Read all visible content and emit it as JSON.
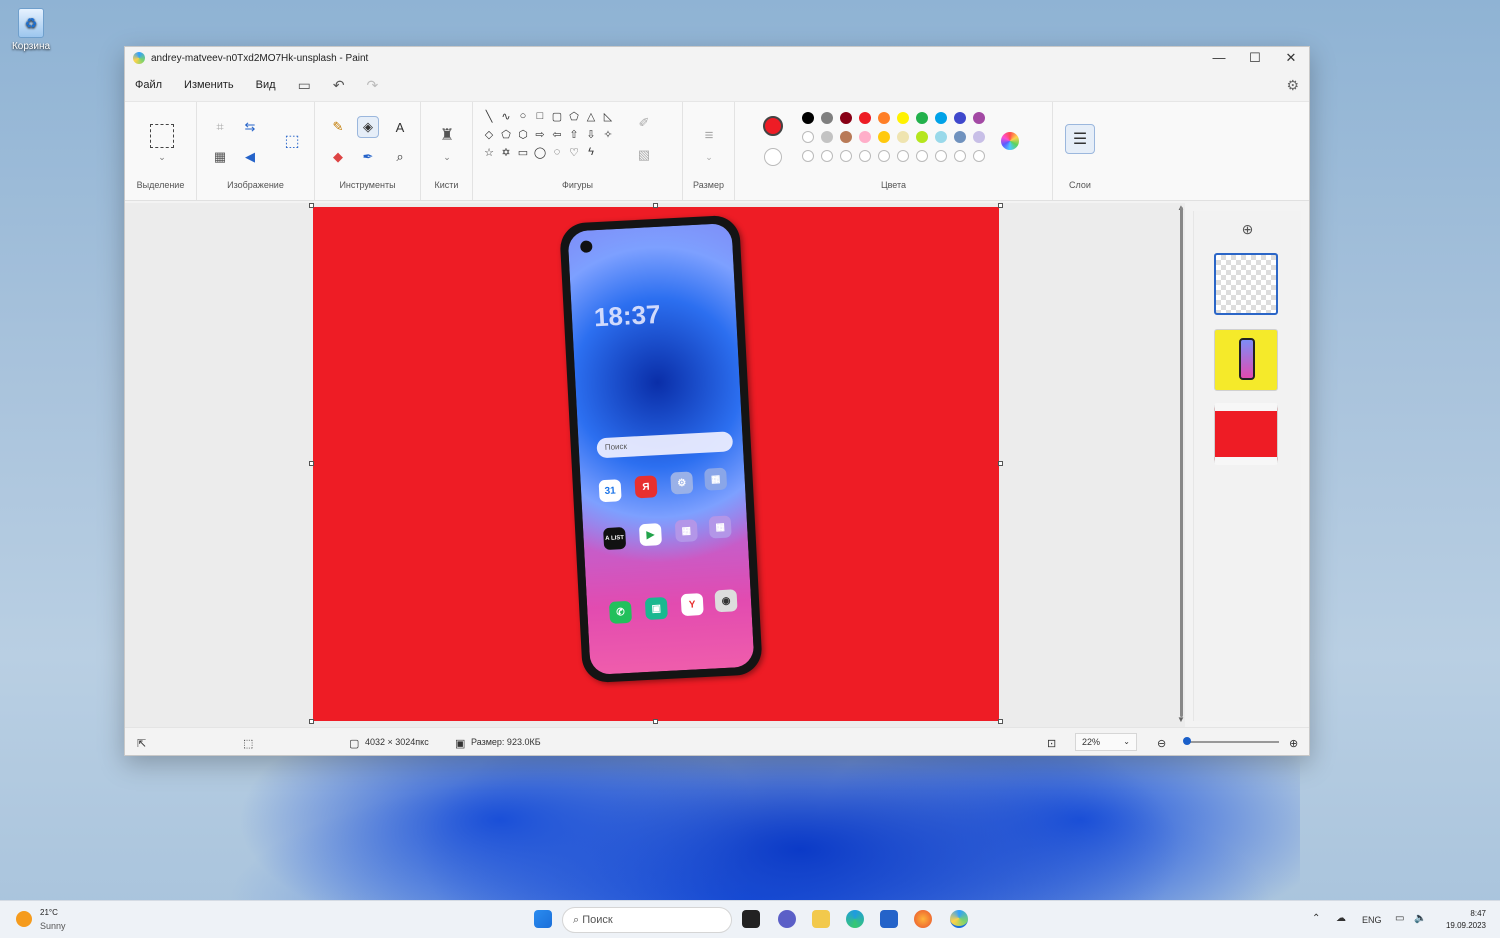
{
  "desktop": {
    "recycle_bin_label": "Корзина"
  },
  "window": {
    "title": "andrey-matveev-n0Txd2MO7Hk-unsplash - Paint",
    "controls": {
      "minimize": "—",
      "maximize": "☐",
      "close": "✕"
    }
  },
  "menu": {
    "file": "Файл",
    "edit": "Изменить",
    "view": "Вид"
  },
  "quick_access": {
    "save_icon": "💾",
    "undo_icon": "↶",
    "redo_icon": "↷",
    "settings_icon": "⚙"
  },
  "ribbon": {
    "groups": {
      "selection": "Выделение",
      "image": "Изображение",
      "tools": "Инструменты",
      "brushes": "Кисти",
      "shapes": "Фигуры",
      "size": "Размер",
      "colors": "Цвета",
      "layers": "Слои"
    },
    "primary_color": "#ee1c25",
    "secondary_color": "#ffffff",
    "palette_row1": [
      "#000000",
      "#7f7f7f",
      "#880015",
      "#ed1c24",
      "#ff7f27",
      "#fff200",
      "#22b14c",
      "#00a2e8",
      "#3f48cc",
      "#a349a4"
    ],
    "palette_row2": [
      "#ffffff",
      "#c3c3c3",
      "#b97a57",
      "#ffaec9",
      "#ffc90e",
      "#efe4b0",
      "#b5e61d",
      "#99d9ea",
      "#7092be",
      "#c8bfe7"
    ]
  },
  "canvas": {
    "background_color": "#ee1c25",
    "phone": {
      "clock": "18:37",
      "search_placeholder": "Поиск",
      "apps": [
        "31",
        "Я",
        "⚙",
        "▦",
        "A LIST",
        "▶",
        "▦",
        "▦"
      ],
      "dock_apps": [
        "✆",
        "▣",
        "Y",
        "◉"
      ]
    }
  },
  "layers": {
    "add_icon": "⊕"
  },
  "status": {
    "dimensions": "4032 × 3024пкс",
    "size": "Размер: 923.0КБ",
    "zoom": "22%"
  },
  "taskbar": {
    "temperature": "21°C",
    "weather": "Sunny",
    "search_placeholder": "Поиск",
    "language": "ENG",
    "time": "8:47",
    "date": "19.09.2023"
  }
}
